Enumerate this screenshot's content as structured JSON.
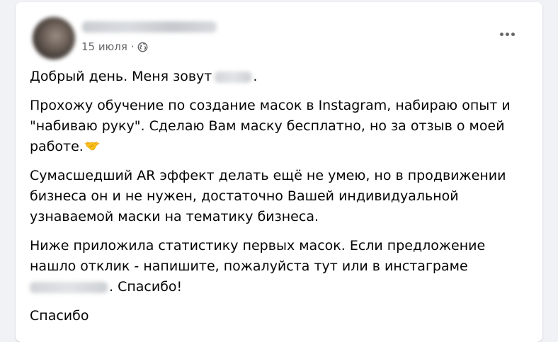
{
  "post": {
    "date": "15 июля",
    "separator": "·",
    "audience_icon": "globe-icon",
    "more_icon": "more-options-icon",
    "paragraphs": {
      "p1_start": "Добрый день. Меня зовут",
      "p1_end": ".",
      "p2": "Прохожу обучение по создание масок в Instagram, набираю опыт и \"набиваю руку\". Сделаю Вам маску бесплатно, но за отзыв о моей работе.",
      "p2_emoji": "handshake-emoji",
      "p3": "Сумасшедший AR эффект делать ещё не умею, но в продвижении бизнеса он и не нужен, достаточно Вашей индивидуальной узнаваемой маски на тематику бизнеса.",
      "p4_start": "Ниже приложила статистику первых масок. Если предложение нашло отклик - напишите, пожалуйста тут или в инстаграме",
      "p4_end": ". Спасибо!",
      "p5": "Спасибо"
    }
  }
}
